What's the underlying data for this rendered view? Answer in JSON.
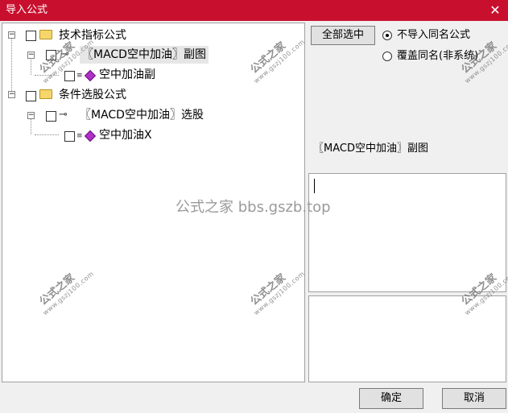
{
  "window": {
    "title": "导入公式",
    "close_glyph": "✕"
  },
  "tree": {
    "group_indicator": "技术指标公式",
    "item_indicator": "〖MACD空中加油〗副图",
    "item_indicator_child": "空中加油副",
    "group_selector": "条件选股公式",
    "item_selector": "〖MACD空中加油〗选股",
    "item_selector_child": "空中加油X",
    "expander_glyph": "−"
  },
  "options": {
    "select_all_label": "全部选中",
    "radio_no_import": "不导入同名公式",
    "radio_overwrite": "覆盖同名(非系统)"
  },
  "detail": {
    "formula_name": "〖MACD空中加油〗副图"
  },
  "footer": {
    "ok_label": "确定",
    "cancel_label": "取消"
  },
  "watermark": {
    "stamp_text": "公式之家",
    "stamp_url": "www.gszj100.com",
    "center_text": "公式之家 bbs.gszb.top"
  }
}
